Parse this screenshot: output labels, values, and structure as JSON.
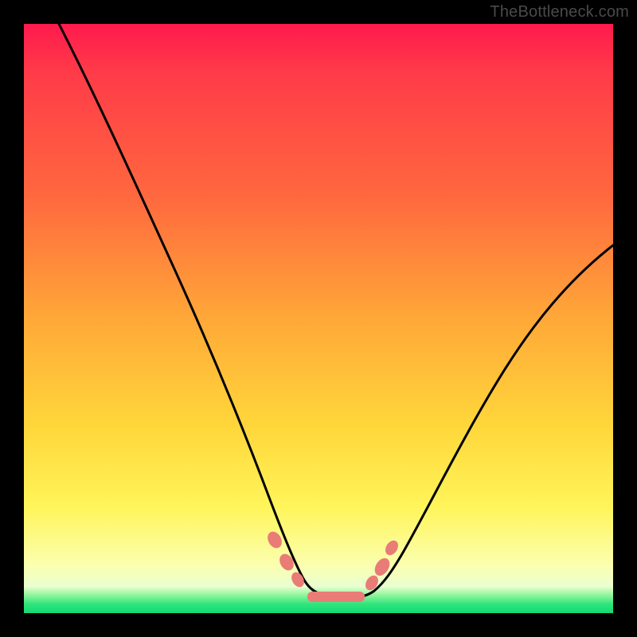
{
  "watermark": {
    "text": "TheBottleneck.com"
  },
  "colors": {
    "frame": "#000000",
    "curve_stroke": "#000000",
    "marker_fill": "#e97c76",
    "marker_stroke": "#e97c76",
    "gradient_stops": [
      "#ff1a4d",
      "#ff3a49",
      "#ff6a3e",
      "#ffa838",
      "#ffd63a",
      "#fff55a",
      "#fbffb0",
      "#e9ffd0",
      "#8cf59a",
      "#2fe47c",
      "#12db74"
    ]
  },
  "chart_data": {
    "type": "line",
    "title": "",
    "xlabel": "",
    "ylabel": "",
    "xlim": [
      0,
      100
    ],
    "ylim": [
      0,
      100
    ],
    "note": "Axes unlabeled; all values estimated from pixel positions on a 0–100 normalized scale. y=0 is the bottom (green) edge, y=100 is the top (red) edge. The curve is a V-shaped bottleneck profile with a flat minimum segment near y≈3 spanning roughly x≈46–58, then rising again on the right but not reaching the top.",
    "series": [
      {
        "name": "bottleneck-curve",
        "x": [
          6,
          10,
          15,
          20,
          25,
          30,
          35,
          38,
          40,
          42,
          44,
          46,
          48,
          50,
          52,
          54,
          56,
          58,
          60,
          62,
          64,
          68,
          72,
          76,
          80,
          84,
          88,
          92,
          96,
          100
        ],
        "y": [
          100,
          89,
          77,
          65,
          54,
          42,
          31,
          24,
          19,
          14,
          9,
          5,
          3.5,
          3,
          3,
          3,
          3.2,
          4,
          6,
          9,
          12,
          18,
          24,
          30,
          36,
          42,
          48,
          53,
          58,
          62
        ]
      }
    ],
    "markers": {
      "name": "highlight-dots",
      "note": "Rounded salmon markers clustered around the trough on both sides plus a short flat bar at the minimum.",
      "points": [
        {
          "x": 41.5,
          "y": 12
        },
        {
          "x": 43.5,
          "y": 8
        },
        {
          "x": 45.5,
          "y": 5
        },
        {
          "x": 59.0,
          "y": 5.5
        },
        {
          "x": 61.0,
          "y": 9
        },
        {
          "x": 62.5,
          "y": 12
        }
      ],
      "flat_bar": {
        "x0": 47,
        "x1": 57,
        "y": 3
      }
    }
  }
}
